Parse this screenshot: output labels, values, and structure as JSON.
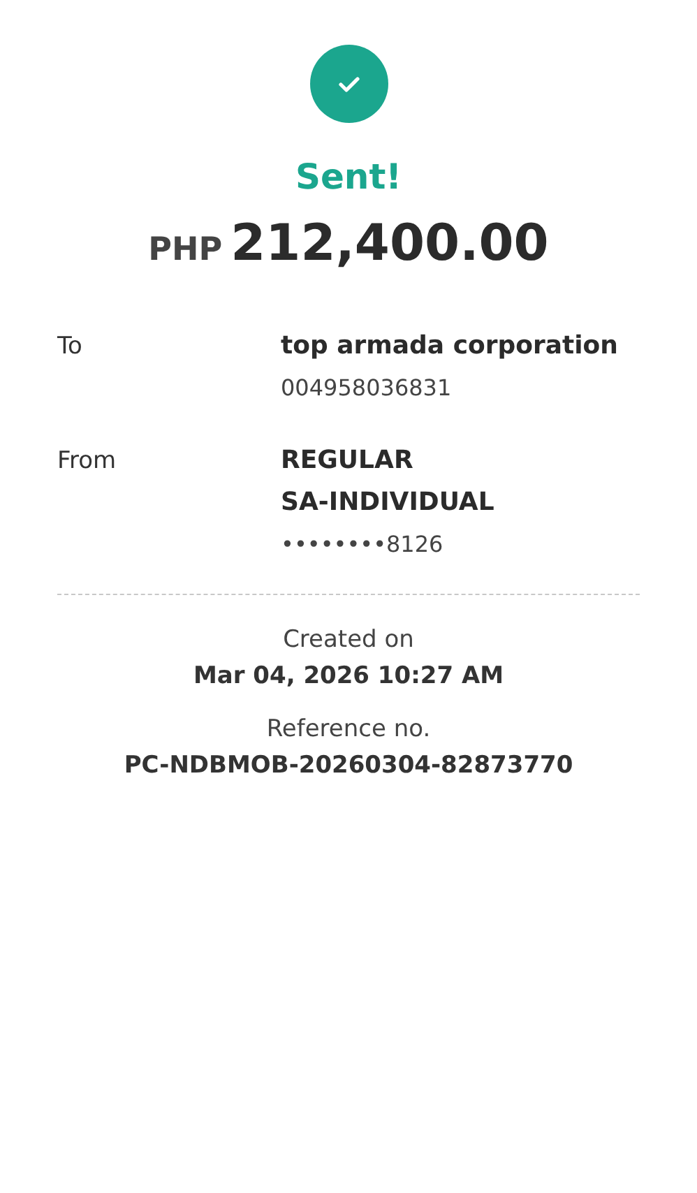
{
  "status": {
    "title": "Sent!",
    "kind": "success"
  },
  "amount": {
    "currency": "PHP",
    "value": "212,400.00"
  },
  "details": [
    {
      "label": "To",
      "lines": [
        {
          "text": "top armada corporation",
          "kind": "primary"
        },
        {
          "text": "004958036831",
          "kind": "secondary"
        }
      ]
    },
    {
      "label": "From",
      "lines": [
        {
          "text": "REGULAR",
          "kind": "primary"
        },
        {
          "text": "SA-INDIVIDUAL",
          "kind": "primary"
        },
        {
          "text": "••••••••8126",
          "kind": "secondary"
        }
      ]
    }
  ],
  "meta": [
    {
      "label": "Created on",
      "value": "Mar 04, 2026 10:27 AM"
    },
    {
      "label": "Reference no.",
      "value": "PC-NDBMOB-20260304-82873770"
    }
  ]
}
